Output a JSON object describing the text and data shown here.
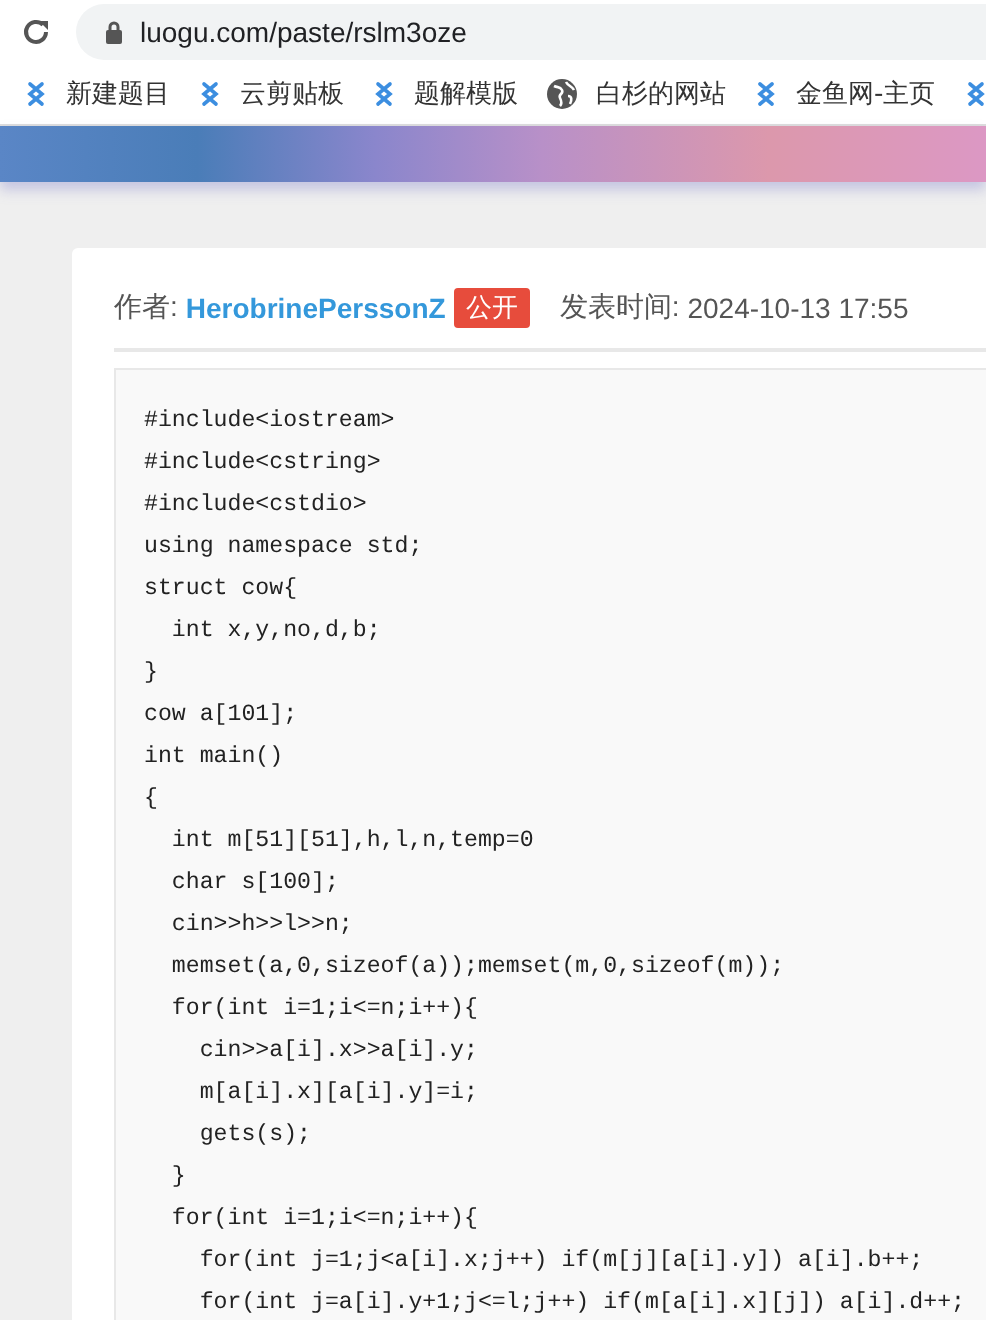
{
  "address_bar": {
    "url": "luogu.com/paste/rslm3oze"
  },
  "bookmarks": [
    {
      "kind": "luogu",
      "label": "新建题目"
    },
    {
      "kind": "luogu",
      "label": "云剪贴板"
    },
    {
      "kind": "luogu",
      "label": "题解模版"
    },
    {
      "kind": "globe",
      "label": "白杉的网站"
    },
    {
      "kind": "luogu",
      "label": "金鱼网-主页"
    },
    {
      "kind": "luogu"
    }
  ],
  "paste": {
    "author_label": "作者:",
    "author": "HerobrinePerssonZ",
    "visibility": "公开",
    "time_label": "发表时间:",
    "time": "2024-10-13 17:55",
    "code": [
      "#include<iostream>",
      "#include<cstring>",
      "#include<cstdio>",
      "using namespace std;",
      "struct cow{",
      "  int x,y,no,d,b;",
      "}",
      "cow a[101];",
      "int main()",
      "{",
      "  int m[51][51],h,l,n,temp=0",
      "  char s[100];",
      "  cin>>h>>l>>n;",
      "  memset(a,0,sizeof(a));memset(m,0,sizeof(m));",
      "  for(int i=1;i<=n;i++){",
      "    cin>>a[i].x>>a[i].y;",
      "    m[a[i].x][a[i].y]=i;",
      "    gets(s);",
      "  }",
      "  for(int i=1;i<=n;i++){",
      "    for(int j=1;j<a[i].x;j++) if(m[j][a[i].y]) a[i].b++;",
      "    for(int j=a[i].y+1;j<=l;j++) if(m[a[i].x][j]) a[i].d++;"
    ]
  }
}
